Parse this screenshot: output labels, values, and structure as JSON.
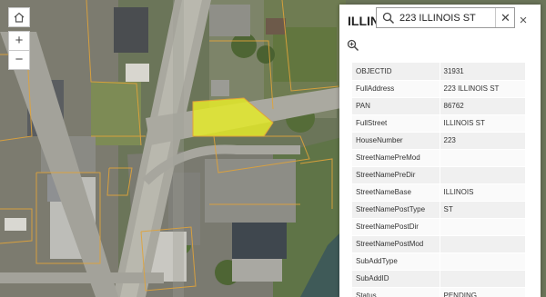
{
  "map": {
    "parcel_outline_color": "#e0a33a",
    "selected_parcel_color": "#e4ea2a",
    "controls": {
      "home_icon": "home-icon",
      "zoom_in_label": "+",
      "zoom_out_label": "−"
    }
  },
  "search": {
    "value": "223 ILLINOIS ST",
    "clear_label": "✕",
    "icon": "search-icon"
  },
  "popup": {
    "title": "ILLINOIS",
    "close_label": "×",
    "zoom_icon": "zoom-to-icon",
    "rows": [
      {
        "key": "OBJECTID",
        "value": "31931"
      },
      {
        "key": "FullAddress",
        "value": "223 ILLINOIS ST"
      },
      {
        "key": "PAN",
        "value": "86762"
      },
      {
        "key": "FullStreet",
        "value": "ILLINOIS ST"
      },
      {
        "key": "HouseNumber",
        "value": "223"
      },
      {
        "key": "StreetNamePreMod",
        "value": ""
      },
      {
        "key": "StreetNamePreDir",
        "value": ""
      },
      {
        "key": "StreetNameBase",
        "value": "ILLINOIS"
      },
      {
        "key": "StreetNamePostType",
        "value": "ST"
      },
      {
        "key": "StreetNamePostDir",
        "value": ""
      },
      {
        "key": "StreetNamePostMod",
        "value": ""
      },
      {
        "key": "SubAddType",
        "value": ""
      },
      {
        "key": "SubAddID",
        "value": ""
      },
      {
        "key": "Status",
        "value": "PENDING"
      }
    ]
  }
}
